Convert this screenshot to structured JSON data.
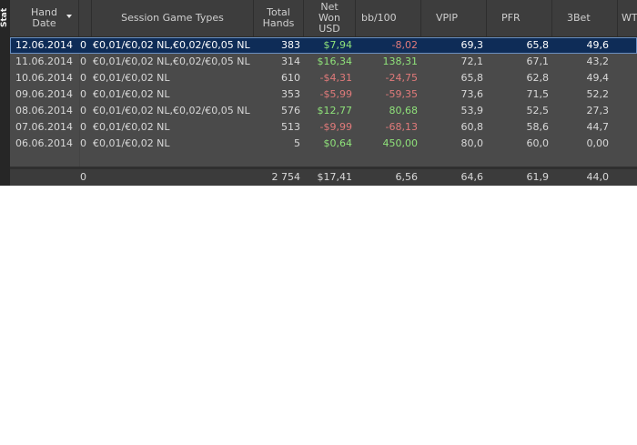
{
  "side_tab": {
    "label": "Stat"
  },
  "columns": {
    "hand_date": "Hand\nDate",
    "hand_date_l1": "Hand",
    "hand_date_l2": "Date",
    "session_game_types": "Session Game Types",
    "total_hands_l1": "Total",
    "total_hands_l2": "Hands",
    "net_won_l1": "Net",
    "net_won_l2": "Won",
    "net_won_l3": "USD",
    "bb100": "bb/100",
    "vpip": "VPIP",
    "pfr": "PFR",
    "threebet": "3Bet",
    "wt": "WT"
  },
  "rows": [
    {
      "date": "12.06.2014",
      "count": "0",
      "types": "€0,01/€0,02 NL,€0,02/€0,05 NL",
      "hands": "383",
      "net": "$7,94",
      "bb": "-8,02",
      "vpip": "69,3",
      "pfr": "65,8",
      "threebet": "49,6"
    },
    {
      "date": "11.06.2014",
      "count": "0",
      "types": "€0,01/€0,02 NL,€0,02/€0,05 NL",
      "hands": "314",
      "net": "$16,34",
      "bb": "138,31",
      "vpip": "72,1",
      "pfr": "67,1",
      "threebet": "43,2"
    },
    {
      "date": "10.06.2014",
      "count": "0",
      "types": "€0,01/€0,02 NL",
      "hands": "610",
      "net": "-$4,31",
      "bb": "-24,75",
      "vpip": "65,8",
      "pfr": "62,8",
      "threebet": "49,4"
    },
    {
      "date": "09.06.2014",
      "count": "0",
      "types": "€0,01/€0,02 NL",
      "hands": "353",
      "net": "-$5,99",
      "bb": "-59,35",
      "vpip": "73,6",
      "pfr": "71,5",
      "threebet": "52,2"
    },
    {
      "date": "08.06.2014",
      "count": "0",
      "types": "€0,01/€0,02 NL,€0,02/€0,05 NL",
      "hands": "576",
      "net": "$12,77",
      "bb": "80,68",
      "vpip": "53,9",
      "pfr": "52,5",
      "threebet": "27,3"
    },
    {
      "date": "07.06.2014",
      "count": "0",
      "types": "€0,01/€0,02 NL",
      "hands": "513",
      "net": "-$9,99",
      "bb": "-68,13",
      "vpip": "60,8",
      "pfr": "58,6",
      "threebet": "44,7"
    },
    {
      "date": "06.06.2014",
      "count": "0",
      "types": "€0,01/€0,02 NL",
      "hands": "5",
      "net": "$0,64",
      "bb": "450,00",
      "vpip": "80,0",
      "pfr": "60,0",
      "threebet": "0,00"
    }
  ],
  "totals": {
    "count": "0",
    "hands": "2 754",
    "net": "$17,41",
    "bb": "6,56",
    "vpip": "64,6",
    "pfr": "61,9",
    "threebet": "44,0"
  },
  "colors": {
    "positive": "#8fe27a",
    "negative": "#e07a7a",
    "selected": "#0e2c57"
  }
}
